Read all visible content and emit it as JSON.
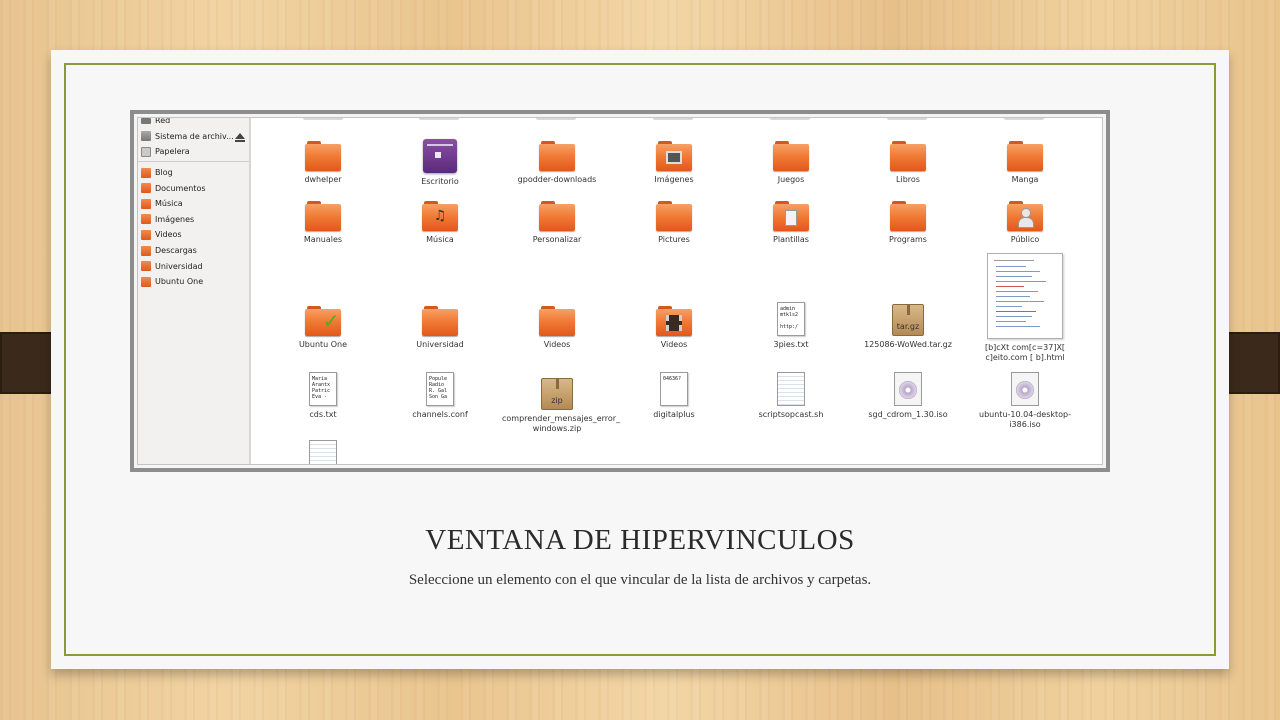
{
  "slide": {
    "title": "VENTANA DE HIPERVINCULOS",
    "subtitle": "Seleccione un elemento con el que vincular de la lista de archivos y carpetas."
  },
  "sidebar": {
    "items": [
      {
        "label": "Red",
        "icon": "network-icon"
      },
      {
        "label": "Sistema de archiv...",
        "icon": "drive-icon"
      },
      {
        "label": "Papelera",
        "icon": "trash-icon"
      },
      {
        "label": "Blog",
        "icon": "folder-icon"
      },
      {
        "label": "Documentos",
        "icon": "folder-documents-icon"
      },
      {
        "label": "Música",
        "icon": "folder-music-icon"
      },
      {
        "label": "Imágenes",
        "icon": "folder-pictures-icon"
      },
      {
        "label": "Videos",
        "icon": "folder-videos-icon"
      },
      {
        "label": "Descargas",
        "icon": "folder-downloads-icon"
      },
      {
        "label": "Universidad",
        "icon": "folder-icon"
      },
      {
        "label": "Ubuntu One",
        "icon": "folder-icon"
      }
    ]
  },
  "files": {
    "row1": [
      "dwhelper",
      "Escritorio",
      "gpodder-downloads",
      "Imágenes",
      "Juegos",
      "Libros",
      "Manga"
    ],
    "row2": [
      "Manuales",
      "Música",
      "Personalizar",
      "Pictures",
      "Plantillas",
      "Programs",
      "Público"
    ],
    "row3": [
      "Ubuntu One",
      "Universidad",
      "Videos",
      "Videos",
      "3pies.txt",
      "125086-WoWed.tar.gz",
      "[b]cXt com[c=37]X[ c]eito.com [ b].html"
    ],
    "row4": [
      "cds.txt",
      "channels.conf",
      "comprender_mensajes_error_ windows.zip",
      "digitalplus",
      "scriptsopcast.sh",
      "sgd_cdrom_1.30.iso",
      "ubuntu-10.04-desktop-i386.iso"
    ],
    "pkg_labels": {
      "targz": "tar.gz",
      "zip": "zip"
    },
    "txt_previews": {
      "3pies": "admin\nmtkls2\n\nhttp:/",
      "cds": "Maria\nArantx\nPatric\nEva -",
      "channels": "Popule\nRadio\nR. Gal\nSon Ga",
      "digitalplus": "04636?"
    }
  }
}
